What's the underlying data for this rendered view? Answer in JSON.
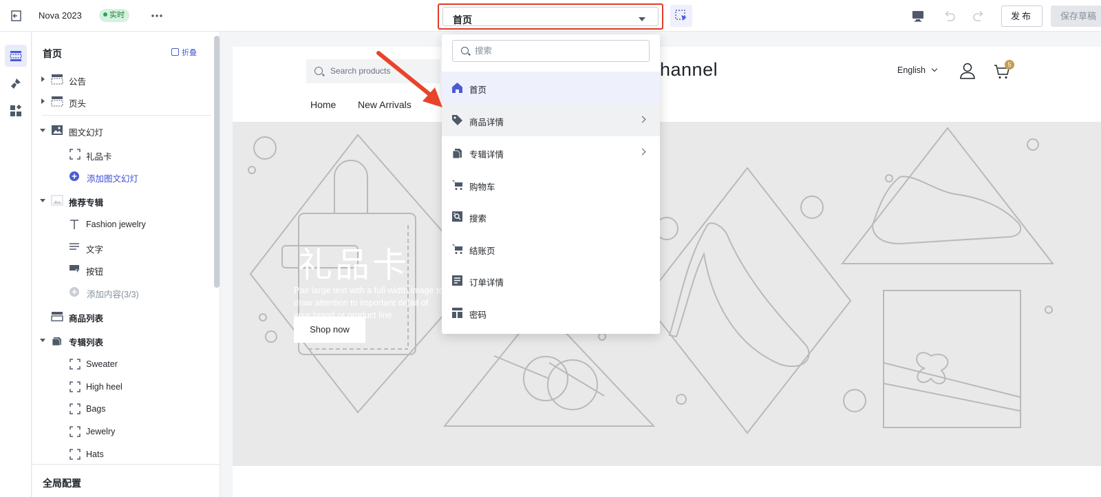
{
  "topbar": {
    "title": "Nova 2023",
    "live_badge": "实时",
    "page_selector": "首页",
    "publish": "发布",
    "save_draft": "保存草稿"
  },
  "panel": {
    "title": "首页",
    "collapse": "折叠",
    "items": [
      {
        "label": "公告"
      },
      {
        "label": "页头"
      },
      {
        "label": "图文幻灯"
      },
      {
        "label": "礼品卡"
      },
      {
        "label": "添加图文幻灯"
      },
      {
        "label": "推荐专辑"
      },
      {
        "label": "Fashion jewelry"
      },
      {
        "label": "文字"
      },
      {
        "label": "按钮"
      },
      {
        "label": "添加内容(3/3)"
      },
      {
        "label": "商品列表"
      },
      {
        "label": "专辑列表"
      },
      {
        "label": "Sweater"
      },
      {
        "label": "High heel"
      },
      {
        "label": "Bags"
      },
      {
        "label": "Jewelry"
      },
      {
        "label": "Hats"
      }
    ],
    "footer": "全局配置"
  },
  "store": {
    "search_placeholder": "Search products",
    "logo": "ychannel",
    "language": "English",
    "cart_count": "5",
    "nav": [
      "Home",
      "New Arrivals"
    ],
    "hero_title": "礼品卡",
    "hero_desc": "Pair large text with a full-width image to draw attention to important detail of your brand or product line",
    "hero_button": "Shop now"
  },
  "dropdown": {
    "search_placeholder": "搜索",
    "items": [
      {
        "label": "首页",
        "icon": "home-icon",
        "selected": true
      },
      {
        "label": "商品详情",
        "icon": "tag-icon",
        "has_submenu": true
      },
      {
        "label": "专辑详情",
        "icon": "collection-tag-icon",
        "has_submenu": true
      },
      {
        "label": "购物车",
        "icon": "cart-icon"
      },
      {
        "label": "搜索",
        "icon": "search-box-icon"
      },
      {
        "label": "结账页",
        "icon": "checkout-cart-icon"
      },
      {
        "label": "订单详情",
        "icon": "order-doc-icon"
      },
      {
        "label": "密码",
        "icon": "password-layout-icon"
      }
    ]
  },
  "colors": {
    "accent": "#4a5bd4",
    "highlight_border": "#e03a2a",
    "arrow": "#e8442a",
    "live_badge_bg": "#d4f2de"
  }
}
